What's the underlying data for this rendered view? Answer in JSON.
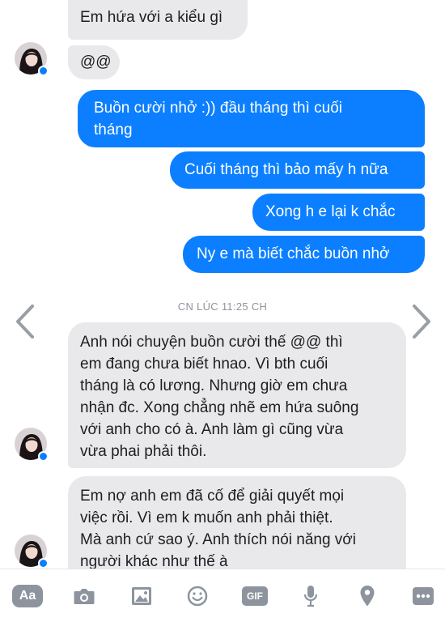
{
  "messages": {
    "in_1": "Em hứa với a kiểu gì",
    "in_2": "@@",
    "out_1_line1": "Buồn cười nhở :)) đầu tháng thì cuối",
    "out_1_line2": "tháng",
    "out_2": "Cuối tháng thì bảo mấy h nữa",
    "out_3": "Xong h e lại k chắc",
    "out_4": "Ny e mà biết chắc buồn nhở",
    "in_3_lines": [
      "Anh nói chuyện buồn cười thế @@ thì",
      "em đang chưa biết hnao. Vì bth cuối",
      "tháng là có lương. Nhưng giờ em chưa",
      "nhận đc. Xong chẳng nhẽ em hứa suông",
      "với anh cho có à. Anh làm gì cũng vừa",
      "vừa phai phải thôi."
    ],
    "in_4_lines": [
      "Em nợ anh em đã cố để giải quyết mọi",
      "việc rồi. Vì em k muốn anh phải thiệt.",
      "Mà anh cứ sao ý. Anh thích nói năng với",
      "người khác như thế à"
    ]
  },
  "timestamp": "CN LÚC 11:25 CH",
  "composer": {
    "text_button": "Aa",
    "gif_button": "GIF"
  },
  "colors": {
    "outgoing": "#0b7fff",
    "incoming": "#e9e9eb",
    "icon": "#8d949e"
  },
  "icons": [
    "camera-icon",
    "image-icon",
    "emoji-icon",
    "gif-icon",
    "microphone-icon",
    "location-icon",
    "more-icon"
  ]
}
